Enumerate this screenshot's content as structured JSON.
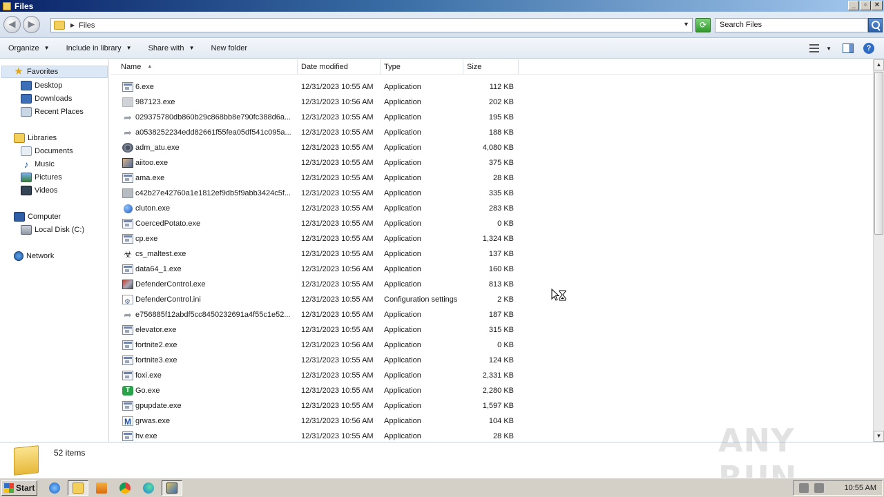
{
  "window": {
    "title": "Files"
  },
  "address": {
    "path": "Files",
    "search_placeholder": "Search Files"
  },
  "toolbar": {
    "organize": "Organize",
    "include_in_library": "Include in library",
    "share_with": "Share with",
    "new_folder": "New folder"
  },
  "nav": {
    "favorites": "Favorites",
    "desktop": "Desktop",
    "downloads": "Downloads",
    "recent_places": "Recent Places",
    "libraries": "Libraries",
    "documents": "Documents",
    "music": "Music",
    "pictures": "Pictures",
    "videos": "Videos",
    "computer": "Computer",
    "local_disk": "Local Disk (C:)",
    "network": "Network"
  },
  "columns": {
    "name": "Name",
    "date": "Date modified",
    "type": "Type",
    "size": "Size"
  },
  "files": [
    {
      "name": "6.exe",
      "date": "12/31/2023 10:55 AM",
      "type": "Application",
      "size": "112 KB",
      "icon": "exe-icon"
    },
    {
      "name": "987123.exe",
      "date": "12/31/2023 10:56 AM",
      "type": "Application",
      "size": "202 KB",
      "icon": "blank-icon"
    },
    {
      "name": "029375780db860b29c868bb8e790fc388d6a...",
      "date": "12/31/2023 10:55 AM",
      "type": "Application",
      "size": "195 KB",
      "icon": "shortcut-icon"
    },
    {
      "name": "a0538252234edd82661f55fea05df541c095a...",
      "date": "12/31/2023 10:55 AM",
      "type": "Application",
      "size": "188 KB",
      "icon": "shortcut-icon"
    },
    {
      "name": "adm_atu.exe",
      "date": "12/31/2023 10:55 AM",
      "type": "Application",
      "size": "4,080 KB",
      "icon": "gear-icon"
    },
    {
      "name": "aiitoo.exe",
      "date": "12/31/2023 10:55 AM",
      "type": "Application",
      "size": "375 KB",
      "icon": "avatar-icon"
    },
    {
      "name": "ama.exe",
      "date": "12/31/2023 10:55 AM",
      "type": "Application",
      "size": "28 KB",
      "icon": "exe-icon"
    },
    {
      "name": "c42b27e42760a1e1812ef9db5f9abb3424c5f...",
      "date": "12/31/2023 10:55 AM",
      "type": "Application",
      "size": "335 KB",
      "icon": "gray-icon"
    },
    {
      "name": "cluton.exe",
      "date": "12/31/2023 10:55 AM",
      "type": "Application",
      "size": "283 KB",
      "icon": "globe-icon"
    },
    {
      "name": "CoercedPotato.exe",
      "date": "12/31/2023 10:55 AM",
      "type": "Application",
      "size": "0 KB",
      "icon": "exe-icon"
    },
    {
      "name": "cp.exe",
      "date": "12/31/2023 10:55 AM",
      "type": "Application",
      "size": "1,324 KB",
      "icon": "exe-icon"
    },
    {
      "name": "cs_maltest.exe",
      "date": "12/31/2023 10:55 AM",
      "type": "Application",
      "size": "137 KB",
      "icon": "biohazard-icon"
    },
    {
      "name": "data64_1.exe",
      "date": "12/31/2023 10:56 AM",
      "type": "Application",
      "size": "160 KB",
      "icon": "exe-icon"
    },
    {
      "name": "DefenderControl.exe",
      "date": "12/31/2023 10:55 AM",
      "type": "Application",
      "size": "813 KB",
      "icon": "defender-icon"
    },
    {
      "name": "DefenderControl.ini",
      "date": "12/31/2023 10:55 AM",
      "type": "Configuration settings",
      "size": "2 KB",
      "icon": "ini-icon"
    },
    {
      "name": "e756885f12abdf5cc8450232691a4f55c1e52...",
      "date": "12/31/2023 10:55 AM",
      "type": "Application",
      "size": "187 KB",
      "icon": "shortcut-icon"
    },
    {
      "name": "elevator.exe",
      "date": "12/31/2023 10:55 AM",
      "type": "Application",
      "size": "315 KB",
      "icon": "exe-icon"
    },
    {
      "name": "fortnite2.exe",
      "date": "12/31/2023 10:56 AM",
      "type": "Application",
      "size": "0 KB",
      "icon": "exe-icon"
    },
    {
      "name": "fortnite3.exe",
      "date": "12/31/2023 10:55 AM",
      "type": "Application",
      "size": "124 KB",
      "icon": "exe-icon"
    },
    {
      "name": "foxi.exe",
      "date": "12/31/2023 10:55 AM",
      "type": "Application",
      "size": "2,331 KB",
      "icon": "exe-icon"
    },
    {
      "name": "Go.exe",
      "date": "12/31/2023 10:55 AM",
      "type": "Application",
      "size": "2,280 KB",
      "icon": "t-icon"
    },
    {
      "name": "gpupdate.exe",
      "date": "12/31/2023 10:55 AM",
      "type": "Application",
      "size": "1,597 KB",
      "icon": "exe-icon"
    },
    {
      "name": "grwas.exe",
      "date": "12/31/2023 10:56 AM",
      "type": "Application",
      "size": "104 KB",
      "icon": "m-icon"
    },
    {
      "name": "hv.exe",
      "date": "12/31/2023 10:55 AM",
      "type": "Application",
      "size": "28 KB",
      "icon": "exe-icon"
    }
  ],
  "status": {
    "item_count": "52 items",
    "watermark": "ANY RUN"
  },
  "taskbar": {
    "start": "Start",
    "clock": "10:55 AM"
  }
}
